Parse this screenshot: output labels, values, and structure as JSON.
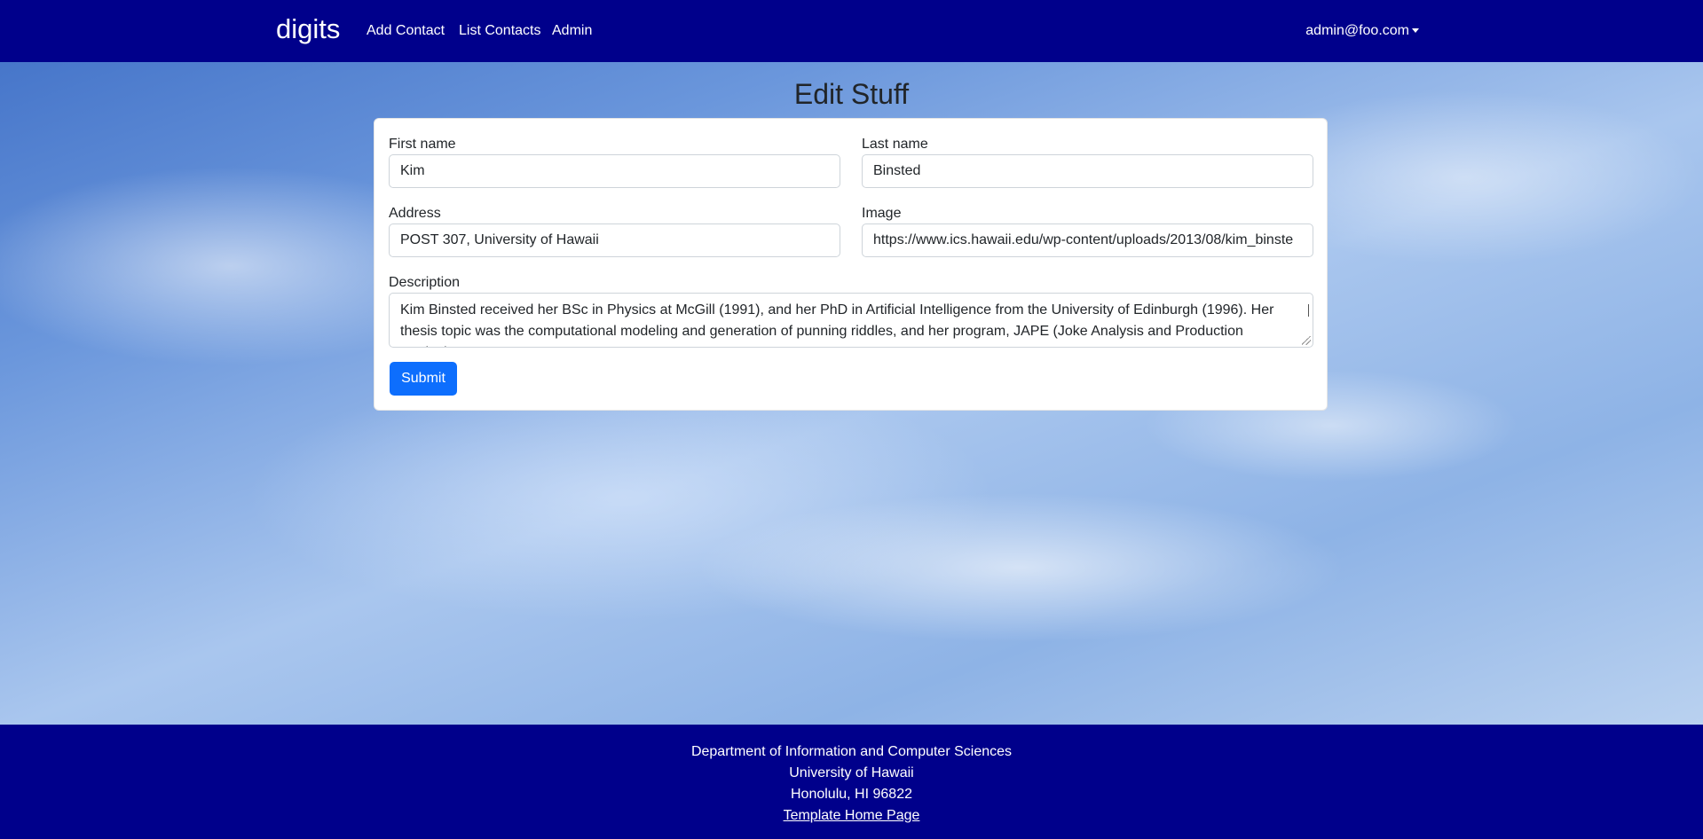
{
  "navbar": {
    "brand": "digits",
    "links": [
      "Add Contact",
      "List Contacts",
      "Admin"
    ],
    "user": "admin@foo.com"
  },
  "page": {
    "title": "Edit Stuff"
  },
  "form": {
    "first_name": {
      "label": "First name",
      "value": "Kim"
    },
    "last_name": {
      "label": "Last name",
      "value": "Binsted"
    },
    "address": {
      "label": "Address",
      "value": "POST 307, University of Hawaii"
    },
    "image": {
      "label": "Image",
      "value": "https://www.ics.hawaii.edu/wp-content/uploads/2013/08/kim_binste"
    },
    "description": {
      "label": "Description",
      "value": "Kim Binsted received her BSc in Physics at McGill (1991), and her PhD in Artificial Intelligence from the University of Edinburgh (1996). Her thesis topic was the computational modeling and generation of punning riddles, and her program, JAPE (Joke Analysis and Production Engine),"
    },
    "submit_label": "Submit"
  },
  "footer": {
    "line1": "Department of Information and Computer Sciences",
    "line2": "University of Hawaii",
    "line3": "Honolulu, HI 96822",
    "link": "Template Home Page"
  },
  "colors": {
    "navbar": "#00008b",
    "primary_button": "#0d6efd"
  }
}
